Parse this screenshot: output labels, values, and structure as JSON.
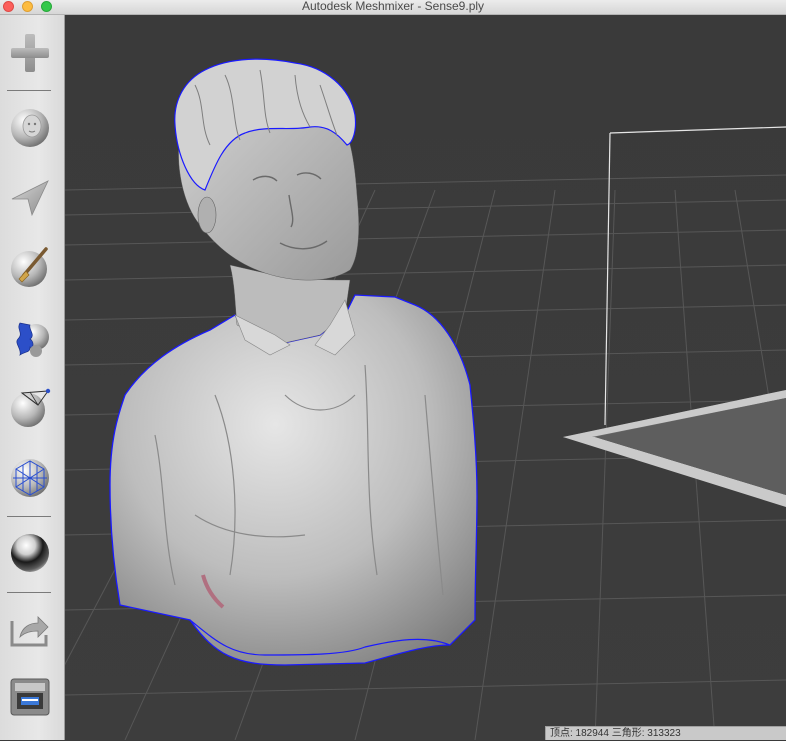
{
  "window": {
    "title": "Autodesk Meshmixer - Sense9.ply"
  },
  "sidebar": {
    "tools": [
      {
        "name": "import",
        "icon": "plus-icon"
      },
      {
        "name": "meshmix",
        "icon": "face-sphere-icon"
      },
      {
        "name": "select",
        "icon": "arrow-cursor-icon"
      },
      {
        "name": "sculpt",
        "icon": "brush-sphere-icon"
      },
      {
        "name": "stamp",
        "icon": "stamp-sphere-icon"
      },
      {
        "name": "edit",
        "icon": "edit-sphere-icon"
      },
      {
        "name": "analysis",
        "icon": "mesh-sphere-icon"
      },
      {
        "name": "shaders",
        "icon": "chrome-sphere-icon"
      },
      {
        "name": "export",
        "icon": "export-tray-icon"
      },
      {
        "name": "print",
        "icon": "printer-icon"
      }
    ]
  },
  "status": {
    "text": "顶点: 182944 三角形: 313323"
  },
  "colors": {
    "boundary": "#1a1aff",
    "grid": "#5a5a5a",
    "platform": "#c8c8c8",
    "mesh": "#c9c9c9"
  }
}
